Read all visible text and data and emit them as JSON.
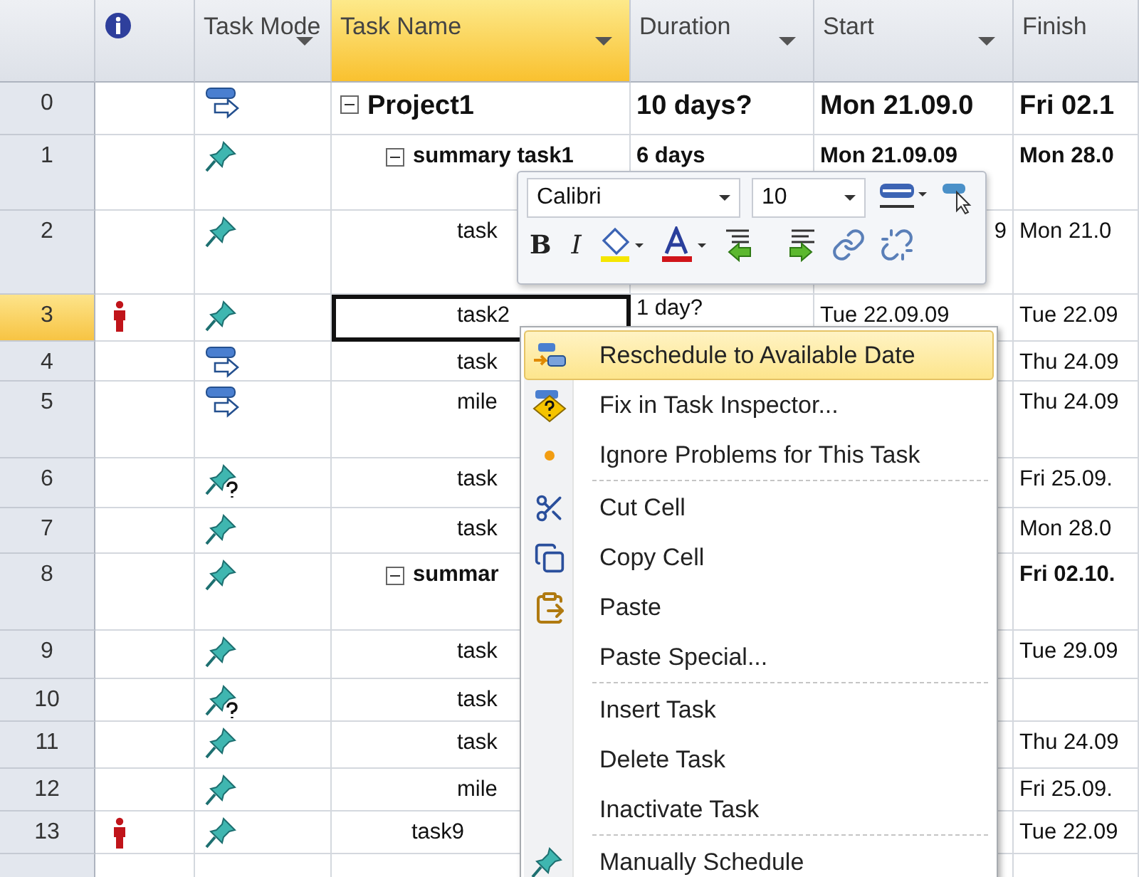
{
  "columns": [
    {
      "kind": "info",
      "selected": false,
      "filter_button": false
    },
    {
      "kind": "text",
      "label": "Task Mode",
      "selected": false,
      "filter_button": true
    },
    {
      "kind": "text",
      "label": "Task Name",
      "selected": true,
      "filter_button": true
    },
    {
      "kind": "text",
      "label": "Duration",
      "selected": false,
      "filter_button": true
    },
    {
      "kind": "text",
      "label": "Start",
      "selected": false,
      "filter_button": true
    },
    {
      "kind": "text",
      "label": "Finish",
      "selected": false,
      "filter_button": false
    }
  ],
  "rows": [
    {
      "id": "0",
      "kind": "auto",
      "name": "Project1",
      "duration": "10 days?",
      "start": "Mon 21.09.0",
      "finish": "Fri 02.1",
      "resource_indicator": false,
      "selected": false,
      "expanded": true,
      "children": [
        {
          "id": "1",
          "kind": "manual",
          "name": "summary task1",
          "duration": "6 days",
          "start": "Mon 21.09.09",
          "finish": "Mon 28.0",
          "resource_indicator": false,
          "selected": false,
          "expanded": true,
          "children": [
            {
              "id": "2",
              "kind": "manual",
              "name": "task",
              "start": "9",
              "finish": "Mon 21.0",
              "resource_indicator": false,
              "selected": false
            },
            {
              "id": "3",
              "kind": "manual",
              "name": "task2",
              "duration": "1 day?",
              "start": "Tue 22.09.09",
              "finish": "Tue 22.09",
              "resource_indicator": true,
              "selected": true
            },
            {
              "id": "4",
              "kind": "auto",
              "name": "task",
              "finish": "Thu 24.09",
              "resource_indicator": false,
              "selected": false
            },
            {
              "id": "5",
              "kind": "auto",
              "name": "mile",
              "finish": "Thu 24.09",
              "resource_indicator": false,
              "selected": false
            },
            {
              "id": "6",
              "kind": "warning",
              "name": "task",
              "finish": "Fri 25.09.",
              "resource_indicator": false,
              "selected": false
            },
            {
              "id": "7",
              "kind": "manual",
              "name": "task",
              "finish": "Mon 28.0",
              "resource_indicator": false,
              "selected": false
            }
          ]
        },
        {
          "id": "8",
          "kind": "manual",
          "name": "summar",
          "finish": "Fri 02.10.",
          "resource_indicator": false,
          "selected": false,
          "expanded": true,
          "children": [
            {
              "id": "9",
              "kind": "manual",
              "name": "task",
              "finish": "Tue 29.09",
              "resource_indicator": false,
              "selected": false
            },
            {
              "id": "10",
              "kind": "warning",
              "name": "task",
              "resource_indicator": false,
              "selected": false
            },
            {
              "id": "11",
              "kind": "manual",
              "name": "task",
              "finish": "Thu 24.09",
              "resource_indicator": false,
              "selected": false
            },
            {
              "id": "12",
              "kind": "manual",
              "name": "mile",
              "finish": "Fri 25.09.",
              "resource_indicator": false,
              "selected": false
            }
          ]
        },
        {
          "id": "13",
          "kind": "manual",
          "name": "task9",
          "finish": "Tue 22.09",
          "resource_indicator": true,
          "selected": false
        }
      ]
    }
  ],
  "mini_toolbar": {
    "font": "Calibri",
    "size": "10",
    "bold_label": "B",
    "italic_label": "I"
  },
  "context_menu": [
    {
      "kind": "item",
      "label": "Reschedule to Available Date",
      "selected": true
    },
    {
      "kind": "item",
      "label": "Fix in Task Inspector...",
      "selected": false
    },
    {
      "kind": "item",
      "label": "Ignore Problems for This Task",
      "selected": false
    },
    {
      "kind": "separator"
    },
    {
      "kind": "item",
      "label": "Cut Cell",
      "selected": false
    },
    {
      "kind": "item",
      "label": "Copy Cell",
      "selected": false
    },
    {
      "kind": "item",
      "label": "Paste",
      "selected": false
    },
    {
      "kind": "item",
      "label": "Paste Special...",
      "selected": false
    },
    {
      "kind": "separator"
    },
    {
      "kind": "item",
      "label": "Insert Task",
      "selected": false
    },
    {
      "kind": "item",
      "label": "Delete Task",
      "selected": false
    },
    {
      "kind": "item",
      "label": "Inactivate Task",
      "selected": false
    },
    {
      "kind": "separator"
    },
    {
      "kind": "item",
      "label": "Manually Schedule",
      "selected": false
    }
  ]
}
